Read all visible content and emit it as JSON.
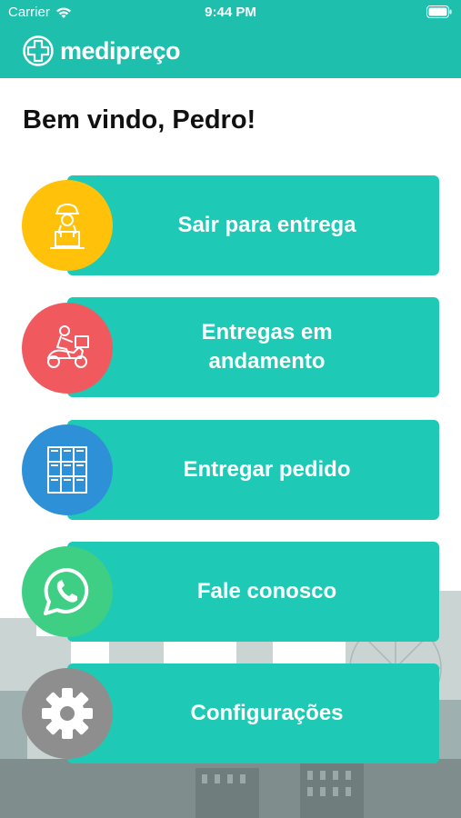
{
  "status_bar": {
    "carrier": "Carrier",
    "time": "9:44 PM"
  },
  "header": {
    "logo_text": "medipreço"
  },
  "welcome_text": "Bem vindo, Pedro!",
  "colors": {
    "primary": "#1fbfae",
    "card": "#1ecab5",
    "icon_yellow": "#ffc10a",
    "icon_red": "#f05a5f",
    "icon_blue": "#2e91d8",
    "icon_green": "#3fcf84",
    "icon_gray": "#8e8e8e"
  },
  "menu": [
    {
      "label": "Sair para entrega",
      "icon": "delivery-person-icon"
    },
    {
      "label": "Entregas em andamento",
      "icon": "scooter-icon"
    },
    {
      "label": "Entregar pedido",
      "icon": "locker-icon"
    },
    {
      "label": "Fale conosco",
      "icon": "whatsapp-icon"
    },
    {
      "label": "Configurações",
      "icon": "gear-icon"
    }
  ]
}
